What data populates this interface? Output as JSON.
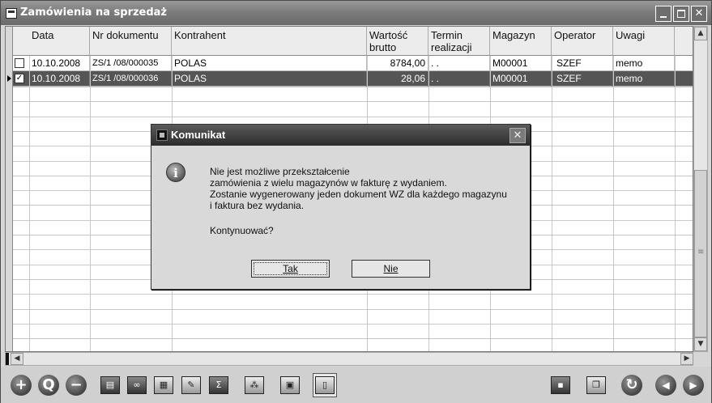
{
  "window": {
    "title": "Zamówienia na sprzedaż",
    "controls": {
      "minimize": "_",
      "maximize": "□",
      "close": "✕"
    }
  },
  "table": {
    "columns": [
      "Data",
      "Nr dokumentu",
      "Kontrahent",
      "Wartość brutto",
      "Termin realizacji",
      "Magazyn",
      "Operator",
      "Uwagi"
    ],
    "header_lines": {
      "wartosc": [
        "Wartość",
        "brutto"
      ],
      "termin": [
        "Termin",
        "realizacji"
      ]
    },
    "rows": [
      {
        "checked": false,
        "selected": false,
        "data": "10.10.2008",
        "nr": "ZS/1 /08/000035",
        "kontrahent": "POLAS",
        "wartosc": "8784,00",
        "termin": ". .",
        "magazyn": "M00001",
        "operator": "SZEF",
        "uwagi": "memo"
      },
      {
        "checked": true,
        "selected": true,
        "data": "10.10.2008",
        "nr": "ZS/1 /08/000036",
        "kontrahent": "POLAS",
        "wartosc": "28,06",
        "termin": ". .",
        "magazyn": "M00001",
        "operator": "SZEF",
        "uwagi": "memo"
      }
    ]
  },
  "dialog": {
    "title": "Komunikat",
    "close": "✕",
    "icon": "info-icon",
    "lines": [
      "Nie jest możliwe przekształcenie",
      "zamówienia z wielu magazynów w fakturę z wydaniem.",
      "Zostanie wygenerowany jeden dokument WZ dla każdego magazynu",
      "i faktura bez wydania."
    ],
    "question": "Kontynuować?",
    "yes_label": "Tak",
    "no_label": "Nie"
  },
  "toolbar": {
    "icons": [
      "add-icon",
      "search-icon",
      "remove-icon",
      "print-icon",
      "binoculars-icon",
      "filter-icon",
      "edit-icon",
      "sum-icon",
      "structure-icon",
      "export-icon",
      "document-icon",
      "save-icon",
      "copy-icon",
      "refresh-icon",
      "prev-icon",
      "next-icon"
    ],
    "add_glyph": "+",
    "remove_glyph": "−",
    "sum_glyph": "Σ",
    "prev_glyph": "◀",
    "next_glyph": "▶",
    "refresh_glyph": "↻"
  }
}
